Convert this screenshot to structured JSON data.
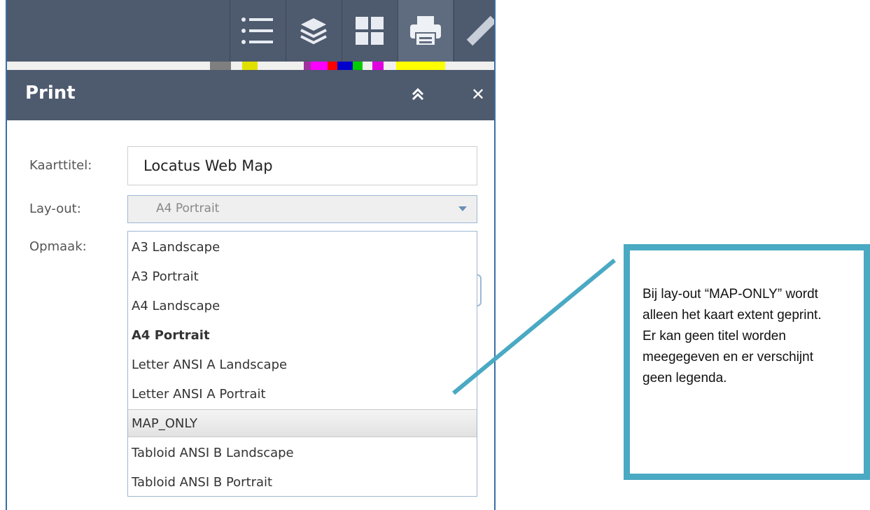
{
  "toolbar": {
    "tools": [
      {
        "icon": "legend-list-icon",
        "active": false
      },
      {
        "icon": "layers-icon",
        "active": false
      },
      {
        "icon": "basemap-gallery-icon",
        "active": false
      },
      {
        "icon": "print-icon",
        "active": true
      },
      {
        "icon": "measure-ruler-icon",
        "active": false
      }
    ]
  },
  "panel": {
    "title": "Print",
    "collapse_icon": "double-chevron-up-icon",
    "close_label": "✕"
  },
  "form": {
    "map_title_label": "Kaarttitel:",
    "map_title_value": "Locatus Web Map",
    "layout_label": "Lay-out:",
    "layout_value": "A4 Portrait",
    "format_label": "Opmaak:"
  },
  "layout_options": [
    {
      "label": "A3 Landscape"
    },
    {
      "label": "A3 Portrait"
    },
    {
      "label": "A4 Landscape"
    },
    {
      "label": "A4 Portrait",
      "selected": true
    },
    {
      "label": "Letter ANSI A Landscape"
    },
    {
      "label": "Letter ANSI A Portrait"
    },
    {
      "label": "MAP_ONLY",
      "hovered": true
    },
    {
      "label": "Tabloid ANSI B Landscape"
    },
    {
      "label": "Tabloid ANSI B Portrait"
    }
  ],
  "callout": {
    "text": "Bij lay-out “MAP-ONLY” wordt alleen het kaart extent geprint. Er kan geen titel worden meegegeven en er verschijnt geen legenda."
  },
  "colors": {
    "header_bg": "#4e5a6e",
    "callout_border": "#4aa9c3",
    "panel_border": "#3a6ea5"
  }
}
